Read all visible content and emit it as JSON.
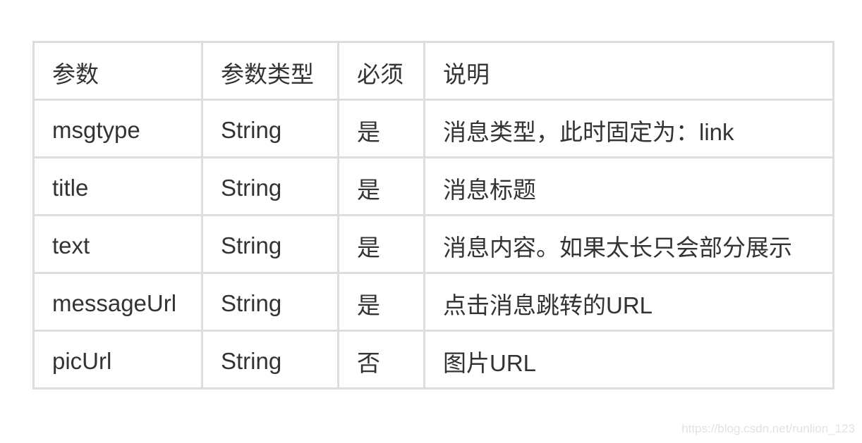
{
  "table": {
    "headers": [
      "参数",
      "参数类型",
      "必须",
      "说明"
    ],
    "rows": [
      {
        "param": "msgtype",
        "type": "String",
        "required": "是",
        "description": "消息类型，此时固定为：link"
      },
      {
        "param": "title",
        "type": "String",
        "required": "是",
        "description": "消息标题"
      },
      {
        "param": "text",
        "type": "String",
        "required": "是",
        "description": "消息内容。如果太长只会部分展示"
      },
      {
        "param": "messageUrl",
        "type": "String",
        "required": "是",
        "description": "点击消息跳转的URL"
      },
      {
        "param": "picUrl",
        "type": "String",
        "required": "否",
        "description": "图片URL"
      }
    ]
  },
  "watermark": "https://blog.csdn.net/runlion_123",
  "colors": {
    "border": "#dddddd",
    "text": "#333333",
    "watermark": "#e2e2e2"
  }
}
